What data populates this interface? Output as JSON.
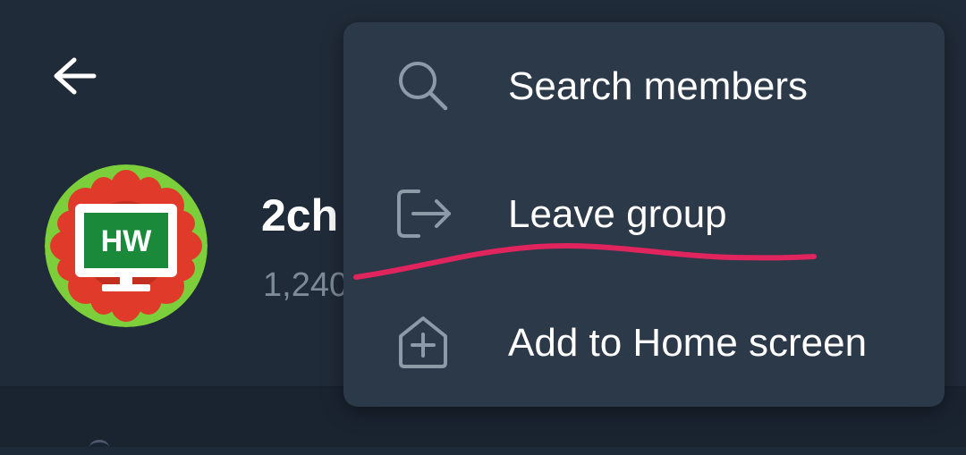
{
  "header": {
    "back_icon": "arrow-left-icon",
    "group_name": "2ch",
    "member_count": "1,240",
    "avatar_text": "HW",
    "avatar_colors": {
      "ring": "#7ccf3a",
      "petals": "#e03a2a",
      "screen": "#1a8a3a",
      "monitor": "#ffffff"
    }
  },
  "menu": {
    "items": [
      {
        "label": "Search members",
        "icon": "search-icon"
      },
      {
        "label": "Leave group",
        "icon": "leave-icon"
      },
      {
        "label": "Add to Home screen",
        "icon": "add-home-icon"
      }
    ]
  },
  "annotation": {
    "color": "#e0245e",
    "type": "red-underline"
  },
  "colors": {
    "background": "#202b39",
    "menu_background": "#2c3949",
    "text_primary": "#ffffff",
    "text_secondary": "#7d8b99",
    "icon": "#8d9aa8"
  }
}
